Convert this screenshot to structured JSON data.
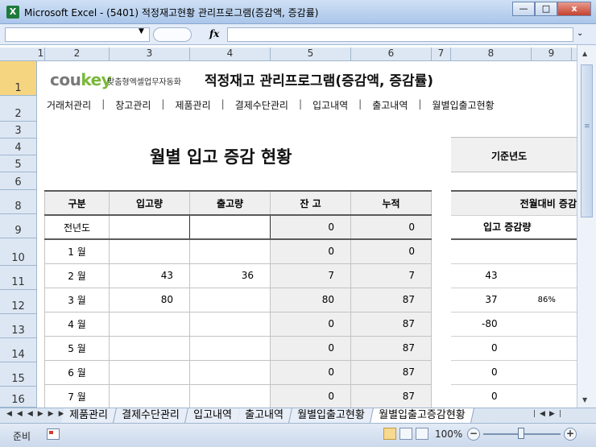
{
  "window": {
    "title": "Microsoft Excel - (5401) 적정재고현황 관리프로그램(증감액, 증감률)",
    "app_icon": "X",
    "controls": {
      "minimize": "—",
      "maximize": "□",
      "close": "x"
    }
  },
  "formula_bar": {
    "name_box": "",
    "fx": "fx",
    "formula": ""
  },
  "columns": [
    "1",
    "2",
    "3",
    "4",
    "5",
    "6",
    "7",
    "8",
    "9"
  ],
  "rows": [
    "1",
    "2",
    "3",
    "4",
    "5",
    "6",
    "8",
    "9",
    "10",
    "11",
    "12",
    "13",
    "14",
    "15",
    "16"
  ],
  "active_row": "1",
  "sheet": {
    "brand": {
      "logo_prefix": "cou",
      "logo_suffix": "key",
      "tagline": "맞춤형엑셀업무자동화"
    },
    "app_title": "적정재고 관리프로그램(증감액, 증감률)",
    "menu": [
      "거래처관리",
      "창고관리",
      "제품관리",
      "결제수단관리",
      "입고내역",
      "출고내역",
      "월별입출고현황"
    ],
    "menu_separator": "|",
    "heading": "월별 입고 증감 현황",
    "base_year_label": "기준년도",
    "table": {
      "headers": [
        "구분",
        "입고량",
        "출고량",
        "잔 고",
        "누적"
      ],
      "rows": [
        {
          "label": "전년도",
          "in": "",
          "out": "",
          "balance": "0",
          "cumulative": "0"
        },
        {
          "label": "1 월",
          "in": "",
          "out": "",
          "balance": "0",
          "cumulative": "0"
        },
        {
          "label": "2 월",
          "in": "43",
          "out": "36",
          "balance": "7",
          "cumulative": "7"
        },
        {
          "label": "3 월",
          "in": "80",
          "out": "",
          "balance": "80",
          "cumulative": "87"
        },
        {
          "label": "4 월",
          "in": "",
          "out": "",
          "balance": "0",
          "cumulative": "87"
        },
        {
          "label": "5 월",
          "in": "",
          "out": "",
          "balance": "0",
          "cumulative": "87"
        },
        {
          "label": "6 월",
          "in": "",
          "out": "",
          "balance": "0",
          "cumulative": "87"
        },
        {
          "label": "7 월",
          "in": "",
          "out": "",
          "balance": "0",
          "cumulative": "87"
        }
      ]
    },
    "comparison": {
      "header": "전월대비 증감",
      "subheader": "입고 증감량",
      "rows": [
        {
          "change": "",
          "rate": ""
        },
        {
          "change": "43",
          "rate": ""
        },
        {
          "change": "37",
          "rate": "86%"
        },
        {
          "change": "-80",
          "rate": ""
        },
        {
          "change": "0",
          "rate": ""
        },
        {
          "change": "0",
          "rate": ""
        },
        {
          "change": "0",
          "rate": ""
        }
      ]
    }
  },
  "sheet_tabs": [
    {
      "label": "제품관리",
      "active": false
    },
    {
      "label": "결제수단관리",
      "active": false
    },
    {
      "label": "입고내역",
      "active": false
    },
    {
      "label": "출고내역",
      "active": false
    },
    {
      "label": "월별입출고현황",
      "active": false
    },
    {
      "label": "월별입출고증감현황",
      "active": true
    }
  ],
  "status_bar": {
    "status": "준비",
    "zoom": "100%",
    "zoom_out": "−",
    "zoom_in": "+"
  }
}
